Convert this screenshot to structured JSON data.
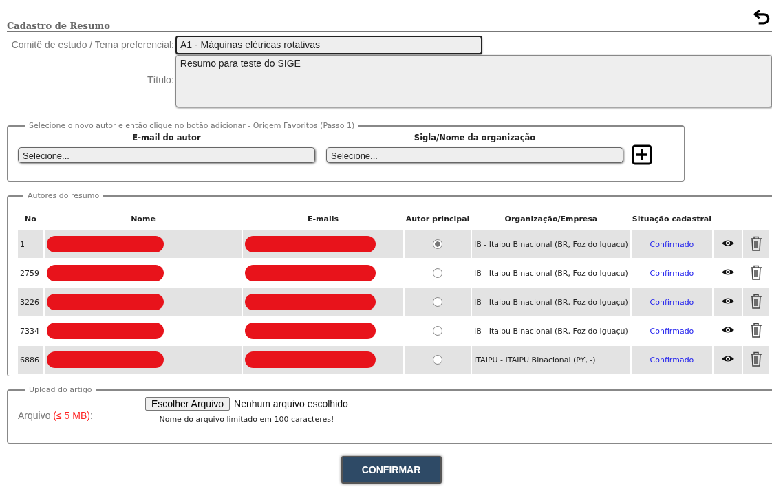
{
  "page_title": "Cadastro de Resumo",
  "form": {
    "committee_label": "Comitê de estudo / Tema preferencial:",
    "committee_value": "A1 - Máquinas elétricas rotativas",
    "title_label": "Título:",
    "title_value": "Resumo para teste do SIGE"
  },
  "add_author": {
    "legend": "Selecione o novo autor e então clique no botão adicionar - Origem Favoritos (Passo 1)",
    "email_label": "E-mail do autor",
    "email_placeholder": "Selecione...",
    "org_label": "Sigla/Nome da organização",
    "org_placeholder": "Selecione..."
  },
  "authors": {
    "legend": "Autores do resumo",
    "columns": [
      "No",
      "Nome",
      "E-mails",
      "Autor principal",
      "Organização/Empresa",
      "Situação cadastral"
    ],
    "rows": [
      {
        "no": "1",
        "name_redacted": true,
        "email_redacted": true,
        "selected": true,
        "organization": "IB - Itaipu Binacional (BR, Foz do Iguaçu)",
        "status": "Confirmado"
      },
      {
        "no": "2759",
        "name_redacted": true,
        "email_redacted": true,
        "selected": false,
        "organization": "IB - Itaipu Binacional (BR, Foz do Iguaçu)",
        "status": "Confirmado"
      },
      {
        "no": "3226",
        "name_redacted": true,
        "email_redacted": true,
        "selected": false,
        "organization": "IB - Itaipu Binacional (BR, Foz do Iguaçu)",
        "status": "Confirmado"
      },
      {
        "no": "7334",
        "name_redacted": true,
        "email_redacted": true,
        "selected": false,
        "organization": "IB - Itaipu Binacional (BR, Foz do Iguaçu)",
        "status": "Confirmado"
      },
      {
        "no": "6886",
        "name_redacted": true,
        "email_redacted": true,
        "selected": false,
        "organization": "ITAIPU - ITAIPU Binacional (PY, -)",
        "status": "Confirmado"
      }
    ]
  },
  "upload": {
    "legend": "Upload do artigo",
    "label": "Arquivo",
    "limit": "(≤ 5 MB)",
    "label_suffix": ":",
    "button": "Escolher Arquivo",
    "file_status": "Nenhum arquivo escolhido",
    "hint": "Nome do arquivo limitado em 100 caracteres!"
  },
  "confirm_button": "CONFIRMAR"
}
